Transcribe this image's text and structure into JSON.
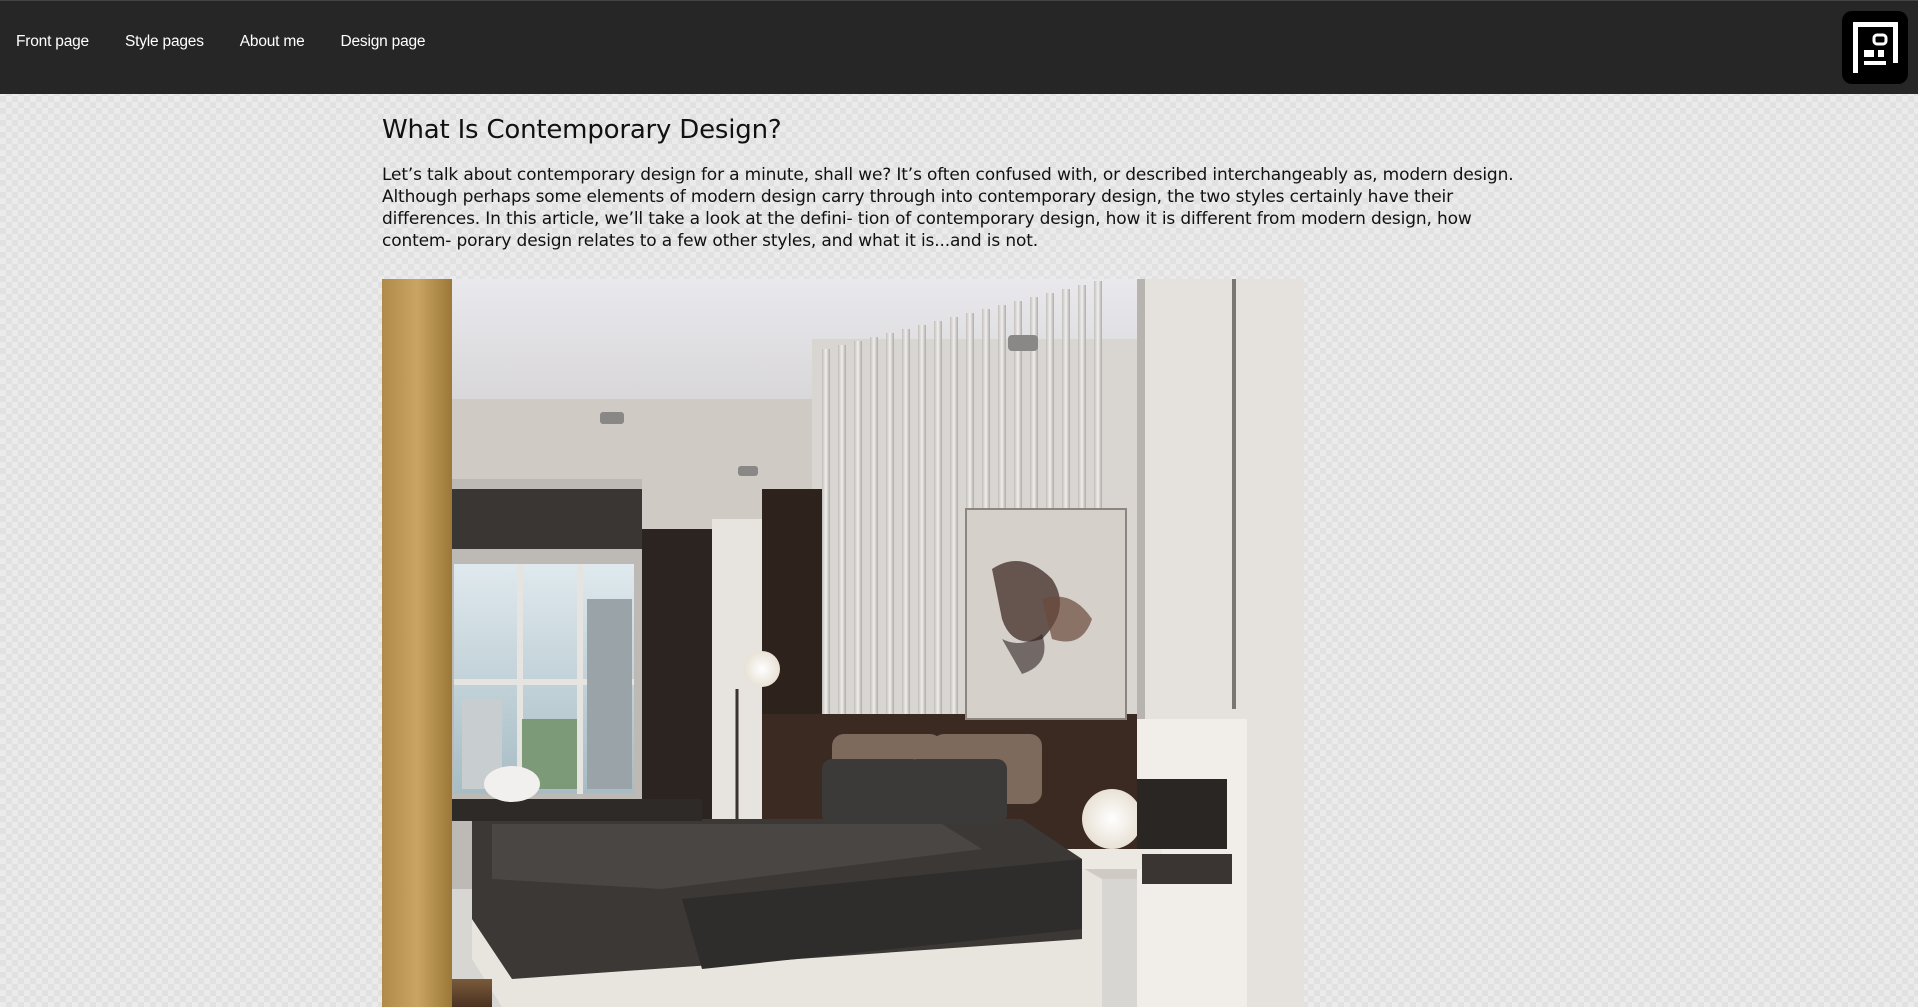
{
  "nav": {
    "items": [
      {
        "label": "Front page"
      },
      {
        "label": "Style pages"
      },
      {
        "label": "About me"
      },
      {
        "label": "Design page"
      }
    ]
  },
  "logo": {
    "icon": "floorplan-logo-icon"
  },
  "article": {
    "title": "What Is Contemporary Design?",
    "intro": "Let’s talk about contemporary design for a minute, shall we? It’s often confused with, or described interchangeably as, modern design. Although perhaps some elements of modern design carry through into contemporary design, the two styles certainly have their differences. In this article, we’ll take a look at the defini- tion of contemporary design, how it is different from modern design, how contem- porary design relates to a few other styles, and what it is...and is not."
  },
  "colors": {
    "topbar": "#262626",
    "background": "#e1e1e1",
    "text": "#111111"
  }
}
